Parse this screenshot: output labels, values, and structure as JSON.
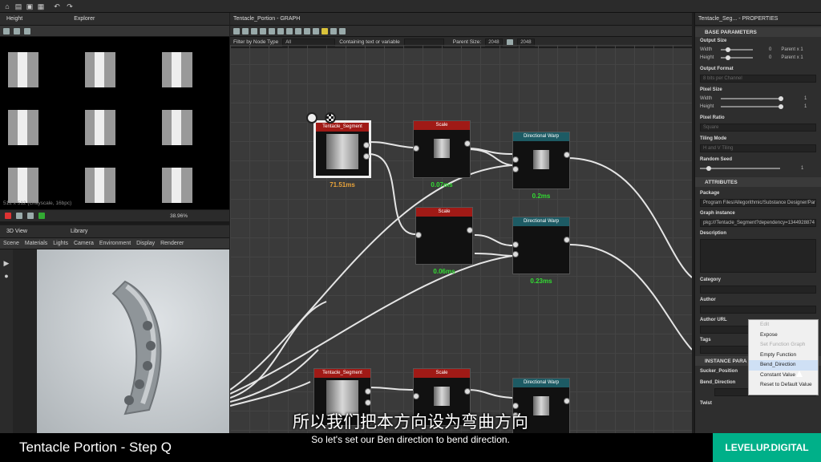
{
  "toolbar": {
    "icons": [
      "home-icon",
      "folder-icon",
      "save-icon",
      "save-all-icon",
      "undo-icon",
      "redo-icon"
    ]
  },
  "left_top": {
    "tabs": [
      "Height",
      "Explorer"
    ],
    "status": "512 x 512 (Grayscale, 16bpc)",
    "zoom": "38.96%"
  },
  "left_bottom": {
    "tabs": [
      "3D View",
      "Library"
    ],
    "menu": [
      "Scene",
      "Materials",
      "Lights",
      "Camera",
      "Environment",
      "Display",
      "Renderer"
    ]
  },
  "graph": {
    "title": "Tentacle_Portion - GRAPH",
    "filter_label": "Filter by Node Type",
    "filter_value": "All",
    "contains_label": "Containing text or variable",
    "parent_size_label": "Parent Size:",
    "parent_w": "2048",
    "parent_h": "2048"
  },
  "nodes": [
    {
      "title": "Tentacle_Segment",
      "color": "red",
      "time": "71.51ms"
    },
    {
      "title": "Scale",
      "color": "red",
      "time": "0.07ms"
    },
    {
      "title": "Directional Warp",
      "color": "teal",
      "time": "0.2ms"
    },
    {
      "title": "Scale",
      "color": "red",
      "time": "0.06ms"
    },
    {
      "title": "Directional Warp",
      "color": "teal",
      "time": "0.23ms"
    },
    {
      "title": "Tentacle_Segment",
      "color": "red",
      "time": ""
    },
    {
      "title": "Scale",
      "color": "red",
      "time": ""
    },
    {
      "title": "Directional Warp",
      "color": "teal",
      "time": ""
    }
  ],
  "props": {
    "title": "Tentacle_Seg... - PROPERTIES",
    "sec_base": "BASE PARAMETERS",
    "output_size": "Output Size",
    "width": "Width",
    "height": "Height",
    "w_val": "0",
    "h_val": "0",
    "parent_w": "Parent x 1",
    "parent_h": "Parent x 1",
    "output_format": "Output Format",
    "format_val": "8 bits per Channel",
    "pixel_size": "Pixel Size",
    "ps_w": "Width",
    "ps_h": "Height",
    "ps_wv": "1",
    "ps_hv": "1",
    "pixel_ratio": "Pixel Ratio",
    "ratio_val": "Square",
    "tiling": "Tiling Mode",
    "tiling_val": "H and V Tiling",
    "seed": "Random Seed",
    "seed_val": "1",
    "sec_attr": "ATTRIBUTES",
    "package": "Package",
    "package_val": "Program Files/Allegorithmic/Substance Designer/Pamself",
    "graph_instance": "Graph instance",
    "graph_val": "pkg:///Tentacle_Segment?dependency=1344928874",
    "description": "Description",
    "category": "Category",
    "author": "Author",
    "author_url": "Author URL",
    "tags": "Tags",
    "sec_instance": "INSTANCE PARA",
    "sucker": "Sucker_Position",
    "bend": "Bend_Direction",
    "bend_val": "Right",
    "twist": "Twist"
  },
  "context_menu": {
    "items": [
      "Edit",
      "Expose",
      "Set Function Graph",
      "Empty Function",
      "Bend_Direction",
      "Constant Value",
      "Reset to Default Value"
    ]
  },
  "subtitle": {
    "zh": "所以我们把本方向设为弯曲方向",
    "en": "So let's set our Ben direction to bend direction."
  },
  "footer": {
    "title": "Tentacle Portion - Step Q",
    "brand": "LEVELUP.DIGITAL"
  },
  "colors": {
    "red": "#a01a16",
    "teal": "#1d5b64",
    "timing": "#e8a33a",
    "timing2": "#33dd33",
    "brand": "#00b089"
  }
}
